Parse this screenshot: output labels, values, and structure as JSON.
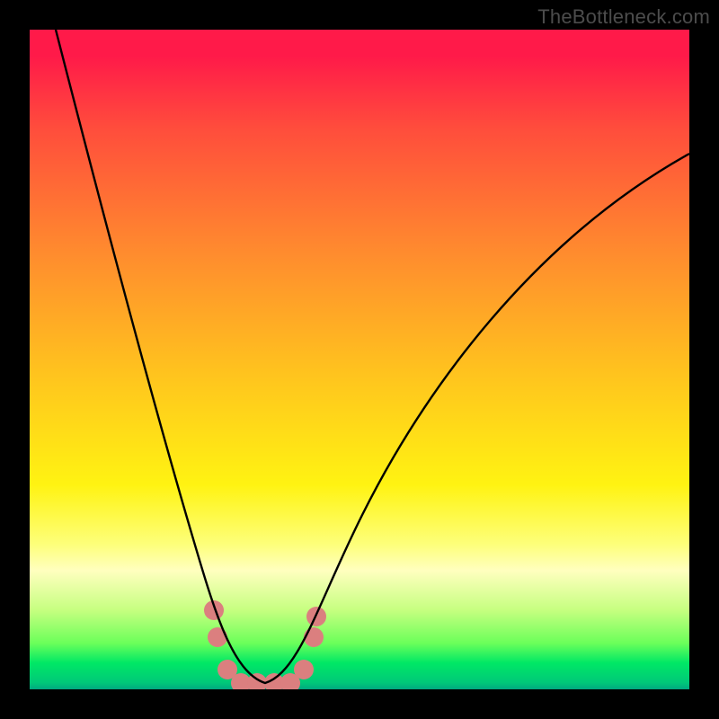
{
  "watermark": "TheBottleneck.com",
  "chart_data": {
    "type": "line",
    "title": "",
    "xlabel": "",
    "ylabel": "",
    "xlim": [
      0,
      100
    ],
    "ylim": [
      0,
      100
    ],
    "background_gradient_stops": [
      {
        "pos": 0,
        "color": "#ff1a49"
      },
      {
        "pos": 15,
        "color": "#ff4d3c"
      },
      {
        "pos": 34,
        "color": "#ff8c2e"
      },
      {
        "pos": 52,
        "color": "#ffc31e"
      },
      {
        "pos": 69,
        "color": "#fff312"
      },
      {
        "pos": 82,
        "color": "#ffffbf"
      },
      {
        "pos": 93,
        "color": "#6bff5a"
      },
      {
        "pos": 100,
        "color": "#00a880"
      }
    ],
    "series": [
      {
        "name": "bottleneck-curve",
        "color": "#000000",
        "x": [
          4,
          10,
          15,
          20,
          25,
          28,
          30,
          32,
          34,
          36,
          38,
          40,
          44,
          50,
          58,
          66,
          74,
          82,
          90,
          100
        ],
        "values": [
          100,
          80,
          63,
          46,
          29,
          18,
          10,
          5,
          2,
          1,
          1,
          2,
          5,
          12,
          24,
          37,
          49,
          60,
          70,
          81
        ]
      }
    ],
    "markers": {
      "name": "highlight-points",
      "color": "#e08080",
      "points": [
        {
          "x": 28.0,
          "y": 12
        },
        {
          "x": 28.5,
          "y": 8
        },
        {
          "x": 30.0,
          "y": 3
        },
        {
          "x": 32.0,
          "y": 1
        },
        {
          "x": 34.5,
          "y": 1
        },
        {
          "x": 37.0,
          "y": 1
        },
        {
          "x": 39.5,
          "y": 1
        },
        {
          "x": 41.5,
          "y": 3
        },
        {
          "x": 43.0,
          "y": 8
        },
        {
          "x": 43.5,
          "y": 11
        }
      ]
    }
  }
}
